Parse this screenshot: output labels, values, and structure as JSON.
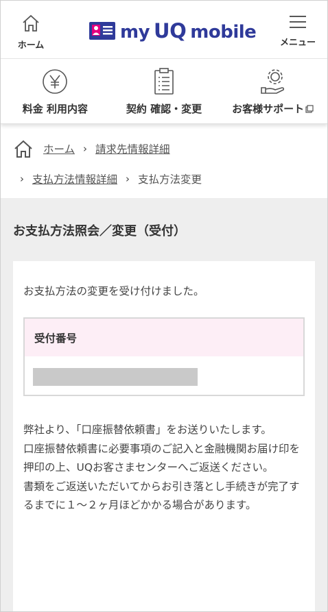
{
  "header": {
    "home_label": "ホーム",
    "logo": {
      "my": "my",
      "uq": "UQ",
      "mobile": "mobile"
    },
    "menu_label": "メニュー"
  },
  "nav": {
    "items": [
      {
        "label": "料金 利用内容",
        "icon": "yen-icon"
      },
      {
        "label": "契約 確認・変更",
        "icon": "clipboard-icon"
      },
      {
        "label": "お客様サポート",
        "icon": "support-gear-icon"
      }
    ]
  },
  "breadcrumb": {
    "home": "ホーム",
    "billing_info": "請求先情報詳細",
    "payment_info": "支払方法情報詳細",
    "current": "支払方法変更"
  },
  "page": {
    "title": "お支払方法照会／変更（受付）",
    "message": "お支払方法の変更を受け付けました。",
    "receipt_header": "受付番号",
    "notice_lines": [
      "弊社より、「口座振替依頼書」をお送りいたします。",
      "口座振替依頼書に必要事項のご記入と金融機関お届け印を押印の上、UQお客さまセンターへご返送ください。",
      "書類をご返送いただいてからお引き落とし手続きが完了するまでに１～２ヶ月ほどかかる場合があります。"
    ]
  },
  "colors": {
    "brand": "#2f3a9a",
    "accent_pink": "#e4007f",
    "receipt_header_bg": "#fdeef6",
    "content_bg": "#eeeeee"
  }
}
